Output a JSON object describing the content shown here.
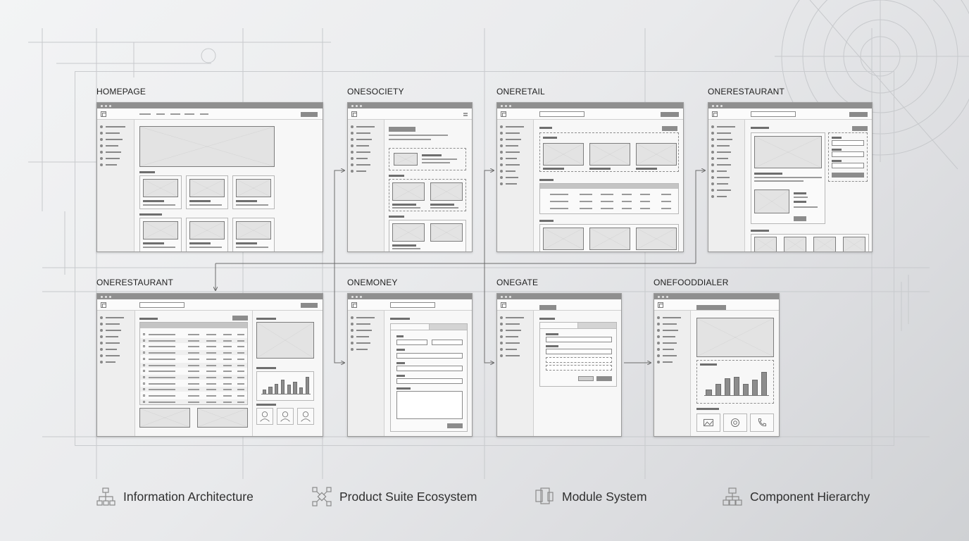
{
  "screens": [
    {
      "id": "homepage",
      "title": "HOMEPAGE"
    },
    {
      "id": "onesociety",
      "title": "ONESOCIETY"
    },
    {
      "id": "oneretail",
      "title": "ONERETAIL"
    },
    {
      "id": "onerestaurant_top",
      "title": "ONERESTAURANT"
    },
    {
      "id": "onerestaurant_bottom",
      "title": "ONERESTAURANT"
    },
    {
      "id": "onemoney",
      "title": "ONEMONEY"
    },
    {
      "id": "onegate",
      "title": "ONEGATE"
    },
    {
      "id": "onefooddialer",
      "title": "ONEFOODDIALER"
    }
  ],
  "chart_bars": {
    "onerestaurant_bottom": [
      0.25,
      0.4,
      0.55,
      0.75,
      0.5,
      0.65,
      0.35,
      0.9
    ],
    "onefooddialer": [
      0.25,
      0.45,
      0.65,
      0.7,
      0.45,
      0.6,
      0.9
    ]
  },
  "legend": [
    {
      "icon": "sitemap-icon",
      "label": "Information Architecture"
    },
    {
      "icon": "network-icon",
      "label": "Product Suite Ecosystem"
    },
    {
      "icon": "modules-icon",
      "label": "Module System"
    },
    {
      "icon": "hierarchy-icon",
      "label": "Component Hierarchy"
    }
  ],
  "colors": {
    "frame": "#9a9a9a",
    "placeholder": "#e3e3e3",
    "line": "#6b6b6b"
  }
}
